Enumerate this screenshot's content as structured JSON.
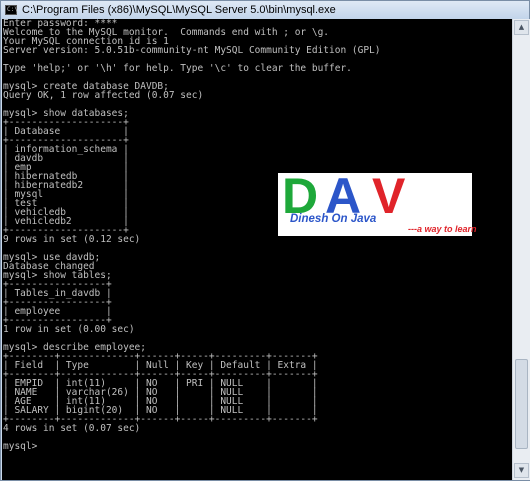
{
  "window": {
    "title": "C:\\Program Files (x86)\\MySQL\\MySQL Server 5.0\\bin\\mysql.exe",
    "app_icon_label": "C:\\"
  },
  "console": {
    "lines": [
      "Enter password: ****",
      "Welcome to the MySQL monitor.  Commands end with ; or \\g.",
      "Your MySQL connection id is 1",
      "Server version: 5.0.51b-community-nt MySQL Community Edition (GPL)",
      "",
      "Type 'help;' or '\\h' for help. Type '\\c' to clear the buffer.",
      "",
      "mysql> create database DAVDB;",
      "Query OK, 1 row affected (0.07 sec)",
      "",
      "mysql> show databases;",
      "+--------------------+",
      "| Database           |",
      "+--------------------+",
      "| information_schema |",
      "| davdb              |",
      "| emp                |",
      "| hibernatedb        |",
      "| hibernatedb2       |",
      "| mysql              |",
      "| test               |",
      "| vehicledb          |",
      "| vehicledb2         |",
      "+--------------------+",
      "9 rows in set (0.12 sec)",
      "",
      "mysql> use davdb;",
      "Database changed",
      "mysql> show tables;",
      "+-----------------+",
      "| Tables_in_davdb |",
      "+-----------------+",
      "| employee        |",
      "+-----------------+",
      "1 row in set (0.00 sec)",
      "",
      "mysql> describe employee;",
      "+--------+-------------+------+-----+---------+-------+",
      "| Field  | Type        | Null | Key | Default | Extra |",
      "+--------+-------------+------+-----+---------+-------+",
      "| EMPID  | int(11)     | NO   | PRI | NULL    |       |",
      "| NAME   | varchar(26) | NO   |     | NULL    |       |",
      "| AGE    | int(11)     | NO   |     | NULL    |       |",
      "| SALARY | bigint(20)  | NO   |     | NULL    |       |",
      "+--------+-------------+------+-----+---------+-------+",
      "4 rows in set (0.07 sec)",
      "",
      "mysql>"
    ]
  },
  "logo": {
    "letter_d": "D",
    "letter_a": "A",
    "letter_v": "V",
    "tagline": "Dinesh On Java",
    "subtitle": "---a way to learn",
    "colors": {
      "d": "#1ea83a",
      "a": "#2c56c9",
      "v": "#e0242a"
    }
  },
  "scrollbar": {
    "up_icon": "triangle-up-icon",
    "down_icon": "triangle-down-icon",
    "up_glyph": "▲",
    "down_glyph": "▼"
  },
  "colors": {
    "console_bg": "#000000",
    "console_text": "#c0c0c0",
    "titlebar": "#c2d4ea"
  }
}
